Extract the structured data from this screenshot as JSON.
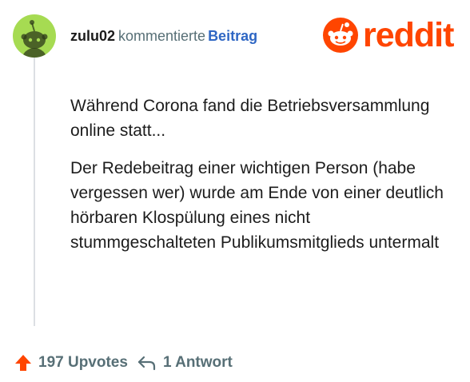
{
  "comment": {
    "username": "zulu02",
    "action_text": "kommentierte",
    "post_link_text": "Beitrag",
    "paragraphs": [
      "Während Corona fand die Betriebsversammlung online statt...",
      "Der Redebeitrag einer wichtigen Person (habe vergessen wer) wurde am Ende von einer deutlich hörbaren Klospülung eines nicht stummgeschalteten Publikumsmitglieds untermalt"
    ]
  },
  "brand": {
    "logo_text": "reddit",
    "accent_color": "#ff4500"
  },
  "footer": {
    "upvote_count": "197 Upvotes",
    "reply_count": "1 Antwort"
  },
  "icons": {
    "avatar": "reddit-snoo-avatar",
    "logo": "reddit-snoo-logo",
    "upvote": "upvote-arrow-icon",
    "reply": "reply-arrow-icon"
  }
}
